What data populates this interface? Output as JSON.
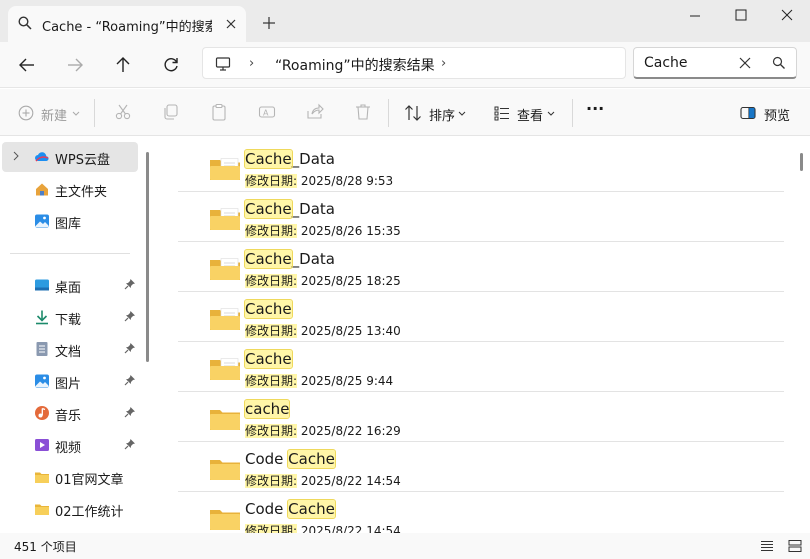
{
  "window": {
    "tab_title": "Cache - “Roaming”中的搜索结",
    "new_tab": "+",
    "minimize": "—",
    "maximize": "□",
    "close": "✕"
  },
  "address": {
    "crumb": "“Roaming”中的搜索结果",
    "sep": "›"
  },
  "search": {
    "value": "Cache"
  },
  "toolbar": {
    "new_label": "新建",
    "sort_label": "排序",
    "view_label": "查看",
    "more_label": "···",
    "preview_label": "预览"
  },
  "sidebar": {
    "items": [
      {
        "label": "WPS云盘"
      },
      {
        "label": "主文件夹"
      },
      {
        "label": "图库"
      },
      {
        "label": "桌面"
      },
      {
        "label": "下载"
      },
      {
        "label": "文档"
      },
      {
        "label": "图片"
      },
      {
        "label": "音乐"
      },
      {
        "label": "视频"
      },
      {
        "label": "01官网文章"
      },
      {
        "label": "02工作统计"
      }
    ]
  },
  "files": [
    {
      "hl": "Cache",
      "rest": "_Data",
      "pre": "",
      "date_label": "修改日期:",
      "date": "2025/8/28 9:53"
    },
    {
      "hl": "Cache",
      "rest": "_Data",
      "pre": "",
      "date_label": "修改日期:",
      "date": "2025/8/26 15:35"
    },
    {
      "hl": "Cache",
      "rest": "_Data",
      "pre": "",
      "date_label": "修改日期:",
      "date": "2025/8/25 18:25"
    },
    {
      "hl": "Cache",
      "rest": "",
      "pre": "",
      "date_label": "修改日期:",
      "date": "2025/8/25 13:40"
    },
    {
      "hl": "Cache",
      "rest": "",
      "pre": "",
      "date_label": "修改日期:",
      "date": "2025/8/25 9:44"
    },
    {
      "hl": "cache",
      "rest": "",
      "pre": "",
      "date_label": "修改日期:",
      "date": "2025/8/22 16:29"
    },
    {
      "hl": "Cache",
      "rest": "",
      "pre": "Code ",
      "date_label": "修改日期:",
      "date": "2025/8/22 14:54"
    },
    {
      "hl": "Cache",
      "rest": "",
      "pre": "Code ",
      "date_label": "修改日期:",
      "date": "2025/8/22 14:54"
    }
  ],
  "status": {
    "count": "451 个项目"
  }
}
